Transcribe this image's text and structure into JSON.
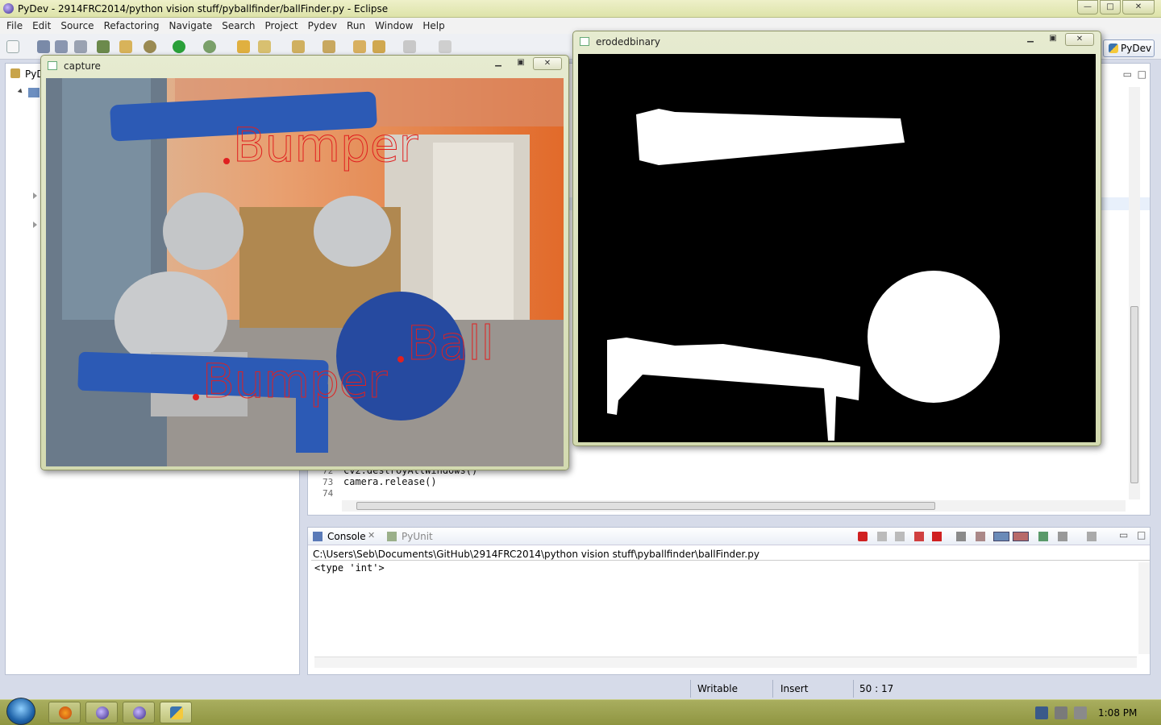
{
  "window": {
    "title": "PyDev - 2914FRC2014/python vision stuff/pyballfinder/ballFinder.py - Eclipse",
    "controls": [
      "—",
      "□",
      "✕"
    ]
  },
  "menu": [
    "File",
    "Edit",
    "Source",
    "Refactoring",
    "Navigate",
    "Search",
    "Project",
    "Pydev",
    "Run",
    "Window",
    "Help"
  ],
  "perspective": {
    "label": "PyDev"
  },
  "explorer": {
    "tab_label": "PyD"
  },
  "editor": {
    "lines": [
      {
        "num": "72",
        "code": "cv2.destroyAllWindows()"
      },
      {
        "num": "73",
        "code": "camera.release()"
      },
      {
        "num": "74",
        "code": ""
      }
    ]
  },
  "console": {
    "tabs": [
      {
        "label": "Console",
        "active": true
      },
      {
        "label": "PyUnit",
        "active": false
      }
    ],
    "path": "C:\\Users\\Seb\\Documents\\GitHub\\2914FRC2014\\python vision stuff\\pyballfinder\\ballFinder.py",
    "output": "<type 'int'>"
  },
  "status": {
    "writable": "Writable",
    "insert": "Insert",
    "position": "50 : 17"
  },
  "capture_window": {
    "title": "capture",
    "labels": [
      {
        "text": "Bumper",
        "target": "bumper-top"
      },
      {
        "text": "Ball",
        "target": "ball"
      },
      {
        "text": "Bumper",
        "target": "bumper-bottom"
      }
    ]
  },
  "eroded_window": {
    "title": "erodedbinary"
  },
  "taskbar": {
    "apps": [
      "firefox",
      "eclipse",
      "eclipse",
      "python"
    ],
    "clock": "1:08 PM"
  },
  "colors": {
    "label_red": "#e0202a",
    "bumper_blue": "#2858b8",
    "eclipse_title": "#e6eab8"
  }
}
